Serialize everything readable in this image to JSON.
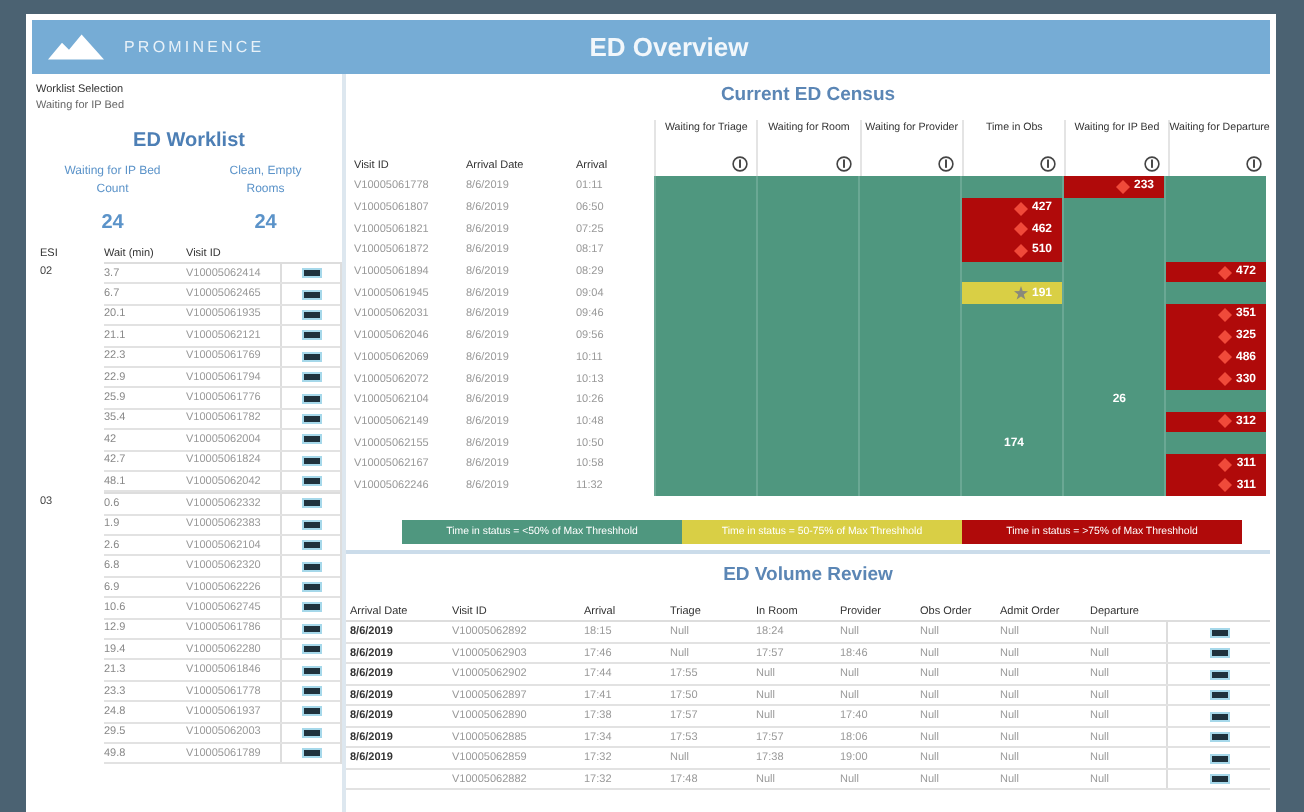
{
  "brand": "PROMINENCE",
  "title": "ED Overview",
  "worklist": {
    "selection_label": "Worklist Selection",
    "selection_value": "Waiting for IP Bed",
    "title": "ED Worklist",
    "stats": [
      {
        "label": "Waiting for IP Bed Count",
        "value": "24"
      },
      {
        "label": "Clean, Empty Rooms",
        "value": "24"
      }
    ],
    "columns": [
      "ESI",
      "Wait (min)",
      "Visit ID"
    ],
    "groups": [
      {
        "esi": "02",
        "rows": [
          [
            "3.7",
            "V10005062414"
          ],
          [
            "6.7",
            "V10005062465"
          ],
          [
            "20.1",
            "V10005061935"
          ],
          [
            "21.1",
            "V10005062121"
          ],
          [
            "22.3",
            "V10005061769"
          ],
          [
            "22.9",
            "V10005061794"
          ],
          [
            "25.9",
            "V10005061776"
          ],
          [
            "35.4",
            "V10005061782"
          ],
          [
            "42",
            "V10005062004"
          ],
          [
            "42.7",
            "V10005061824"
          ],
          [
            "48.1",
            "V10005062042"
          ]
        ]
      },
      {
        "esi": "03",
        "rows": [
          [
            "0.6",
            "V10005062332"
          ],
          [
            "1.9",
            "V10005062383"
          ],
          [
            "2.6",
            "V10005062104"
          ],
          [
            "6.8",
            "V10005062320"
          ],
          [
            "6.9",
            "V10005062226"
          ],
          [
            "10.6",
            "V10005062745"
          ],
          [
            "12.9",
            "V10005061786"
          ],
          [
            "19.4",
            "V10005062280"
          ],
          [
            "21.3",
            "V10005061846"
          ],
          [
            "23.3",
            "V10005061778"
          ],
          [
            "24.8",
            "V10005061937"
          ],
          [
            "29.5",
            "V10005062003"
          ],
          [
            "49.8",
            "V10005061789"
          ]
        ]
      }
    ]
  },
  "census": {
    "title": "Current ED Census",
    "id_columns": [
      "Visit ID",
      "Arrival Date",
      "Arrival"
    ],
    "status_columns": [
      "Waiting for Triage",
      "Waiting for Room",
      "Waiting for Provider",
      "Time in Obs",
      "Waiting for IP Bed",
      "Waiting for Departure"
    ],
    "rows": [
      {
        "visit_id": "V10005061778",
        "date": "8/6/2019",
        "arrival": "01:11",
        "cells": [
          {
            "color": "#4f977f"
          },
          {
            "color": "#4f977f"
          },
          {
            "color": "#4f977f"
          },
          {
            "color": "#4f977f"
          },
          {
            "color": "#b00a0a",
            "kind": "alert",
            "value": "233"
          },
          {
            "color": "#4f977f"
          }
        ]
      },
      {
        "visit_id": "V10005061807",
        "date": "8/6/2019",
        "arrival": "06:50",
        "cells": [
          {
            "color": "#4f977f"
          },
          {
            "color": "#4f977f"
          },
          {
            "color": "#4f977f"
          },
          {
            "color": "#b00a0a",
            "kind": "alert",
            "value": "427"
          },
          {
            "color": "#4f977f"
          },
          {
            "color": "#4f977f"
          }
        ]
      },
      {
        "visit_id": "V10005061821",
        "date": "8/6/2019",
        "arrival": "07:25",
        "cells": [
          {
            "color": "#4f977f"
          },
          {
            "color": "#4f977f"
          },
          {
            "color": "#4f977f"
          },
          {
            "color": "#b00a0a",
            "kind": "alert",
            "value": "462"
          },
          {
            "color": "#4f977f"
          },
          {
            "color": "#4f977f"
          }
        ]
      },
      {
        "visit_id": "V10005061872",
        "date": "8/6/2019",
        "arrival": "08:17",
        "cells": [
          {
            "color": "#4f977f"
          },
          {
            "color": "#4f977f"
          },
          {
            "color": "#4f977f"
          },
          {
            "color": "#b00a0a",
            "kind": "alert",
            "value": "510"
          },
          {
            "color": "#4f977f"
          },
          {
            "color": "#4f977f"
          }
        ]
      },
      {
        "visit_id": "V10005061894",
        "date": "8/6/2019",
        "arrival": "08:29",
        "cells": [
          {
            "color": "#4f977f"
          },
          {
            "color": "#4f977f"
          },
          {
            "color": "#4f977f"
          },
          {
            "color": "#4f977f"
          },
          {
            "color": "#4f977f"
          },
          {
            "color": "#b00a0a",
            "kind": "alert",
            "value": "472"
          }
        ]
      },
      {
        "visit_id": "V10005061945",
        "date": "8/6/2019",
        "arrival": "09:04",
        "cells": [
          {
            "color": "#4f977f"
          },
          {
            "color": "#4f977f"
          },
          {
            "color": "#4f977f"
          },
          {
            "color": "#d9cf45",
            "kind": "warning",
            "value": "191"
          },
          {
            "color": "#4f977f"
          },
          {
            "color": "#4f977f"
          }
        ]
      },
      {
        "visit_id": "V10005062031",
        "date": "8/6/2019",
        "arrival": "09:46",
        "cells": [
          {
            "color": "#4f977f"
          },
          {
            "color": "#4f977f"
          },
          {
            "color": "#4f977f"
          },
          {
            "color": "#4f977f"
          },
          {
            "color": "#4f977f"
          },
          {
            "color": "#b00a0a",
            "kind": "alert",
            "value": "351"
          }
        ]
      },
      {
        "visit_id": "V10005062046",
        "date": "8/6/2019",
        "arrival": "09:56",
        "cells": [
          {
            "color": "#4f977f"
          },
          {
            "color": "#4f977f"
          },
          {
            "color": "#4f977f"
          },
          {
            "color": "#4f977f"
          },
          {
            "color": "#4f977f"
          },
          {
            "color": "#b00a0a",
            "kind": "alert",
            "value": "325"
          }
        ]
      },
      {
        "visit_id": "V10005062069",
        "date": "8/6/2019",
        "arrival": "10:11",
        "cells": [
          {
            "color": "#4f977f"
          },
          {
            "color": "#4f977f"
          },
          {
            "color": "#4f977f"
          },
          {
            "color": "#4f977f"
          },
          {
            "color": "#4f977f"
          },
          {
            "color": "#b00a0a",
            "kind": "alert",
            "value": "486"
          }
        ]
      },
      {
        "visit_id": "V10005062072",
        "date": "8/6/2019",
        "arrival": "10:13",
        "cells": [
          {
            "color": "#4f977f"
          },
          {
            "color": "#4f977f"
          },
          {
            "color": "#4f977f"
          },
          {
            "color": "#4f977f"
          },
          {
            "color": "#4f977f"
          },
          {
            "color": "#b00a0a",
            "kind": "alert",
            "value": "330"
          }
        ]
      },
      {
        "visit_id": "V10005062104",
        "date": "8/6/2019",
        "arrival": "10:26",
        "cells": [
          {
            "color": "#4f977f"
          },
          {
            "color": "#4f977f"
          },
          {
            "color": "#4f977f"
          },
          {
            "color": "#4f977f"
          },
          {
            "color": "#4f977f",
            "kind": "plain",
            "value": "26"
          },
          {
            "color": "#4f977f"
          }
        ]
      },
      {
        "visit_id": "V10005062149",
        "date": "8/6/2019",
        "arrival": "10:48",
        "cells": [
          {
            "color": "#4f977f"
          },
          {
            "color": "#4f977f"
          },
          {
            "color": "#4f977f"
          },
          {
            "color": "#4f977f"
          },
          {
            "color": "#4f977f"
          },
          {
            "color": "#b00a0a",
            "kind": "alert",
            "value": "312"
          }
        ]
      },
      {
        "visit_id": "V10005062155",
        "date": "8/6/2019",
        "arrival": "10:50",
        "cells": [
          {
            "color": "#4f977f"
          },
          {
            "color": "#4f977f"
          },
          {
            "color": "#4f977f"
          },
          {
            "color": "#4f977f",
            "kind": "plain",
            "value": "174"
          },
          {
            "color": "#4f977f"
          },
          {
            "color": "#4f977f"
          }
        ]
      },
      {
        "visit_id": "V10005062167",
        "date": "8/6/2019",
        "arrival": "10:58",
        "cells": [
          {
            "color": "#4f977f"
          },
          {
            "color": "#4f977f"
          },
          {
            "color": "#4f977f"
          },
          {
            "color": "#4f977f"
          },
          {
            "color": "#4f977f"
          },
          {
            "color": "#b00a0a",
            "kind": "alert",
            "value": "311"
          }
        ]
      },
      {
        "visit_id": "V10005062246",
        "date": "8/6/2019",
        "arrival": "11:32",
        "cells": [
          {
            "color": "#4f977f"
          },
          {
            "color": "#4f977f"
          },
          {
            "color": "#4f977f"
          },
          {
            "color": "#4f977f"
          },
          {
            "color": "#4f977f"
          },
          {
            "color": "#b00a0a",
            "kind": "alert",
            "value": "311"
          }
        ]
      }
    ],
    "legend": [
      {
        "color": "#4f977f",
        "label": "Time in status = <50% of Max Threshhold"
      },
      {
        "color": "#d9cf45",
        "label": "Time in status = 50-75% of Max Threshhold"
      },
      {
        "color": "#b00a0a",
        "label": "Time in status = >75% of Max Threshhold"
      }
    ]
  },
  "volume": {
    "title": "ED Volume Review",
    "columns": [
      "Arrival Date",
      "Visit ID",
      "Arrival",
      "Triage",
      "In Room",
      "Provider",
      "Obs Order",
      "Admit Order",
      "Departure"
    ],
    "rows": [
      [
        "8/6/2019",
        "V10005062892",
        "18:15",
        "Null",
        "18:24",
        "Null",
        "Null",
        "Null",
        "Null"
      ],
      [
        "8/6/2019",
        "V10005062903",
        "17:46",
        "Null",
        "17:57",
        "18:46",
        "Null",
        "Null",
        "Null"
      ],
      [
        "8/6/2019",
        "V10005062902",
        "17:44",
        "17:55",
        "Null",
        "Null",
        "Null",
        "Null",
        "Null"
      ],
      [
        "8/6/2019",
        "V10005062897",
        "17:41",
        "17:50",
        "Null",
        "Null",
        "Null",
        "Null",
        "Null"
      ],
      [
        "8/6/2019",
        "V10005062890",
        "17:38",
        "17:57",
        "Null",
        "17:40",
        "Null",
        "Null",
        "Null"
      ],
      [
        "8/6/2019",
        "V10005062885",
        "17:34",
        "17:53",
        "17:57",
        "18:06",
        "Null",
        "Null",
        "Null"
      ],
      [
        "8/6/2019",
        "V10005062859",
        "17:32",
        "Null",
        "17:38",
        "19:00",
        "Null",
        "Null",
        "Null"
      ],
      [
        "",
        "V10005062882",
        "17:32",
        "17:48",
        "Null",
        "Null",
        "Null",
        "Null",
        "Null"
      ]
    ]
  }
}
